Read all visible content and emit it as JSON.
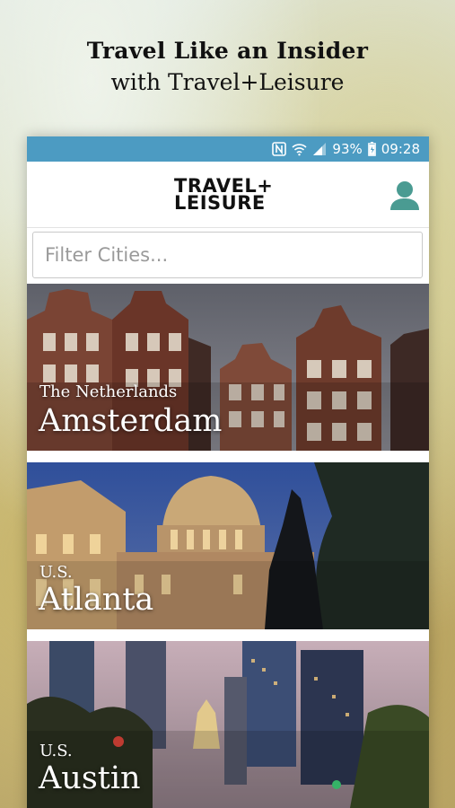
{
  "promo": {
    "title": "Travel Like an Insider",
    "subtitle": "with Travel+Leisure"
  },
  "status_bar": {
    "battery": "93%",
    "time": "09:28",
    "icons": [
      "nfc-icon",
      "wifi-icon",
      "signal-icon",
      "battery-icon"
    ]
  },
  "app_bar": {
    "logo_line1": "TRAVEL+",
    "logo_line2": "LEISURE",
    "profile_icon": "person-icon"
  },
  "filter": {
    "placeholder": "Filter Cities...",
    "value": ""
  },
  "cities": [
    {
      "country": "The Netherlands",
      "city": "Amsterdam"
    },
    {
      "country": "U.S.",
      "city": "Atlanta"
    },
    {
      "country": "U.S.",
      "city": "Austin"
    }
  ],
  "colors": {
    "status_bar": "#4c9bc2",
    "accent": "#4a9b92"
  }
}
